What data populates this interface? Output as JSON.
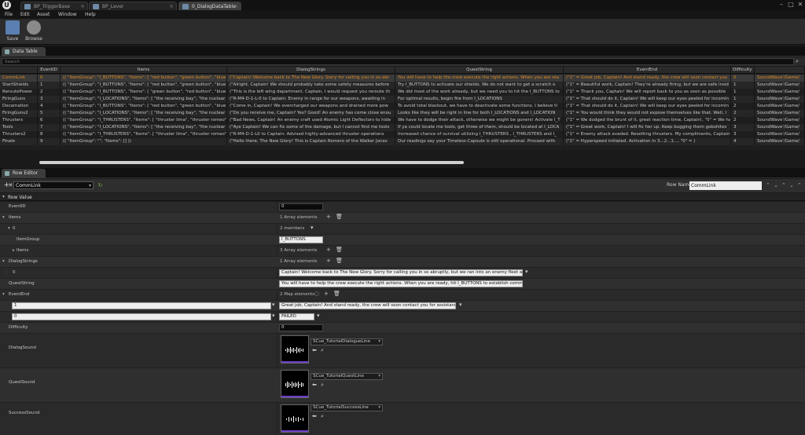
{
  "titlebar": {
    "tabs": [
      "BP_TriggerBase",
      "BP_Lever",
      "0_DialogDataTable"
    ],
    "window_controls": [
      "–",
      "□",
      "✕"
    ]
  },
  "menu": [
    "File",
    "Edit",
    "Asset",
    "Window",
    "Help"
  ],
  "toolbar": {
    "save": "Save",
    "browse": "Browse"
  },
  "data_table": {
    "panel_title": "Data Table",
    "search_placeholder": "Search",
    "columns": [
      "",
      "EventID",
      "Items",
      "DialogStrings",
      "QuestString",
      "EventEnd",
      "Difficulty",
      ""
    ],
    "rows": [
      [
        "CommLink",
        "0",
        "(( \"ItemGroup\": \"I_BUTTONS\", \"Items\": [ \"red button\", \"green button\", \"blue b",
        "(\"Captain! Welcome back to The New Glory. Sorry for calling you in so abr",
        "You will have to help the crew execute the right actions. When you are rea",
        "(\"1\" = Great job, Captain! And stand ready, the crew will soon contact you",
        "0",
        "SoundWave'/Game/"
      ],
      [
        "StartShields",
        "1",
        "(( \"ItemGroup\": \"I_BUTTONS\", \"Items\": [ \"red button\", \"green button\", \"blue b",
        "(\"Alright, Captain! We should probably take some safety measures before",
        "Try I_BUTTONS to activate our shields. We do not want to get a scratch o",
        "(\"1\" = Beautiful work, Captain! They're already firing, but we are safe insid",
        "1",
        "SoundWave'/Game/"
      ],
      [
        "ReroutePower",
        "2",
        "(( \"ItemGroup\": \"I_BUTTONS\", \"Items\": [ \"green button\", \"red button\", \"blue b",
        "(\"This is the left wing department. Captain, I would request you reroute th",
        "We did most of the work already, but we need you to hit the I_BUTTONS to",
        "(\"1\" = Thank you, Captain! We will report back to you as soon as possible",
        "1",
        "SoundWave'/Game/"
      ],
      [
        "FiringGuns",
        "3",
        "(( \"ItemGroup\": \"I_LOCATIONS\", \"Items\": [ \"the receiving bay\", \"the nuclear n",
        "(\"R-M4-D-1-L-0 to Captain: Enemy in range for our weapons, awaiting in",
        "For optimal results, begin fire from I_LOCATIONS",
        "(\"1\" = That should do it, Captain! We will keep our eyes peeled for incomin",
        "1",
        "SoundWave'/Game/"
      ],
      [
        "Decamation",
        "4",
        "(( \"ItemGroup\": \"I_BUTTONS\", \"Items\": [ \"red button\", \"green button\", \"blue b",
        "(\"Come in, Captain! We overcharged our weapons and drained more pow",
        "To avoid total blackout, we have to deactivate some functions. I believe tl",
        "(\"1\" = That should do it, Captain! We will keep our eyes peeled for incomin",
        "2",
        "SoundWave'/Game/"
      ],
      [
        "FiringGuns2",
        "5",
        "(( \"ItemGroup\": \"I_LOCATIONS\", \"Items\": [ \"the receiving bay\", \"the nuclear n",
        "(\"Do you receive me, Captain? Yes? Good! An enemy has come close enou",
        "Looks like they will be right in line for both I_LOCATIONS and I_LOCATION",
        "(\"1\" = You would think they would not expose themselves like that. Well, l",
        "2",
        "SoundWave'/Game/"
      ],
      [
        "Thrusters",
        "6",
        "(( \"ItemGroup\": \"I_THRUSTERS\", \"Items\": [ \"thruster lima\", \"thruster romeo\",",
        "(\"Bad News, Captain! An enemy craft used Atomic Light Deflectors to hide",
        "We have to dodge their attack, otherwise we might be goners! Activate I_T",
        "(\"1\" = We dodged the brunt of it, great reaction time, Captain!, \"0\" = We ha",
        "2",
        "SoundWave'/Game/"
      ],
      [
        "Tools",
        "7",
        "(( \"ItemGroup\": \"I_LOCATIONS\", \"Items\": [ \"the receiving bay\", \"the nuclear n",
        "(\"Aye Captain! We can fix some of the damage, but I cannot find me tools",
        "If ya could locate me tools, get three of them, should be located at I_LOCA",
        "(\"1\" = Great work, Captain! I will fix her up. Keep bugging them gobshites",
        "3",
        "SoundWave'/Game/"
      ],
      [
        "Thrusters2",
        "8",
        "(( \"ItemGroup\": \"I_THRUSTERS\", \"Items\": [ \"thruster lima\", \"thruster romeo\",",
        "(\"R-M4-D-1-L0 to Captain: Advised highly-advanced thruster operations",
        "Increased chance of survival utilizing I_THRUSTERS , I_THRUSTERS and I_",
        "(\"1\" = Enemy attack evaded. Resetting thrusters. My compliments, Captain",
        "3",
        "SoundWave'/Game/"
      ],
      [
        "Finale",
        "9",
        "(( \"ItemGroup\": \"\", \"Items\": [] ))",
        "(\"Hello there, The New Glory! This is Captain Romero of the Walker Jones",
        "Our readings say your Timeless-Capsule is still operational. Proceed with",
        "(\"1\" = Hyperspeed initiated. Activation in 3...2...1..., \"0\" = )",
        "4",
        "SoundWave'/Game/"
      ]
    ]
  },
  "row_editor": {
    "panel_title": "Row Editor",
    "selected_row": "CommLink",
    "row_name_label": "Row Name",
    "row_name_value": "CommLink",
    "section_title": "Row Value",
    "props": {
      "event_id_label": "EventID",
      "event_id_value": "0",
      "items_label": "Items",
      "items_count": "1 Array elements",
      "items_0_label": "0",
      "items_0_count": "2 members",
      "itemgroup_label": "ItemGroup",
      "itemgroup_value": "I_BUTTONS",
      "items_items_label": "Items",
      "items_items_count": "3 Array elements",
      "dialogstrings_label": "DialogStrings",
      "dialogstrings_count": "1 Array elements",
      "dialog_0_label": "0",
      "dialog_0_value": "Captain! Welcome back to The New Glory. Sorry for calling you in so abruptly, but we ran into an enemy fleet a",
      "queststring_label": "QuestString",
      "queststring_value": "You will have to help the crew execute the right actions. When you are ready, hit I_BUTTONS to establish commlin",
      "eventend_label": "EventEnd",
      "eventend_count": "2 Map elements",
      "eventend_key1": "1",
      "eventend_val1": "Great job, Captain! And stand ready, the crew will soon contact you for assistance!",
      "eventend_key2": "0",
      "eventend_val2": "FAILED",
      "difficulty_label": "Difficulty",
      "difficulty_value": "0",
      "dialogsound_label": "DialogSound",
      "dialogsound_asset": "SCue_TutorialDialogueLine",
      "questsound_label": "QuestSound",
      "questsound_asset": "SCue_TutorialQuestLine",
      "successsound_label": "SuccessSound",
      "successsound_asset": "SCue_TutorialSuccessLine"
    }
  }
}
